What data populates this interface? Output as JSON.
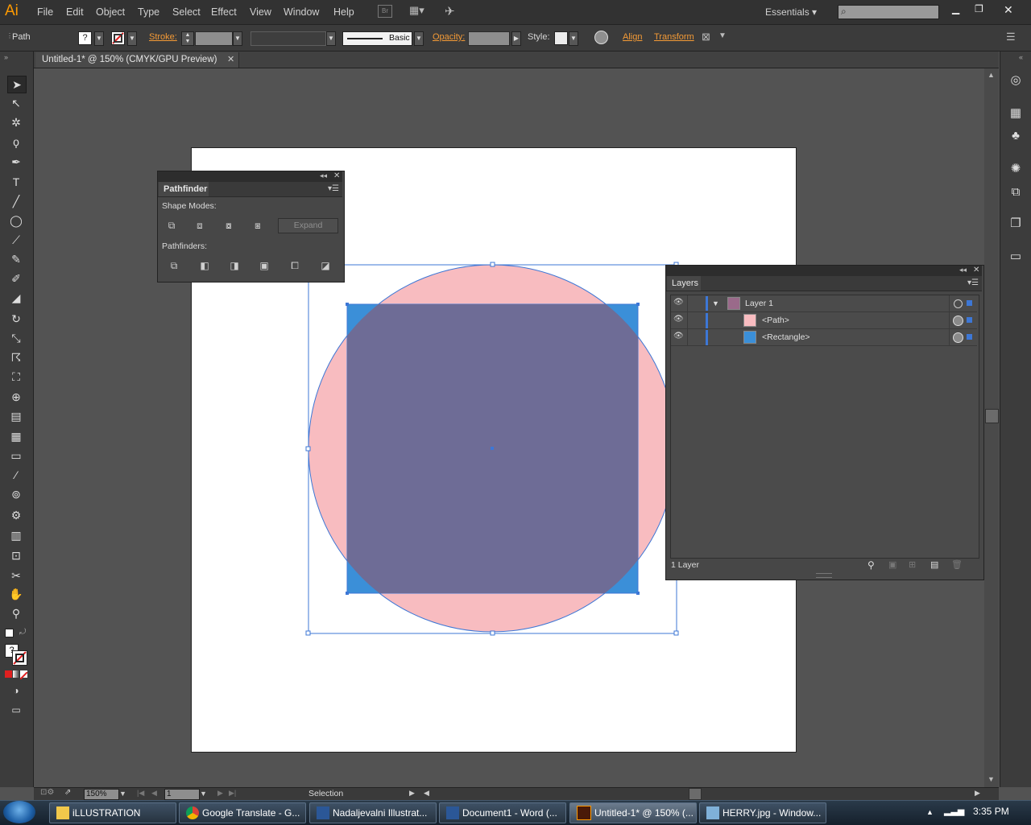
{
  "app": {
    "logo": "Ai"
  },
  "menu": [
    "File",
    "Edit",
    "Object",
    "Type",
    "Select",
    "Effect",
    "View",
    "Window",
    "Help"
  ],
  "workspace": {
    "label": "Essentials",
    "search_placeholder": ""
  },
  "control_bar": {
    "selection_type": "Path",
    "fill_glyph": "?",
    "stroke_label": "Stroke:",
    "brush_label": "Basic",
    "opacity_label": "Opacity:",
    "style_label": "Style:",
    "align_label": "Align",
    "transform_label": "Transform"
  },
  "document": {
    "tab_title": "Untitled-1* @ 150% (CMYK/GPU Preview)"
  },
  "pathfinder": {
    "title": "Pathfinder",
    "shape_modes_label": "Shape Modes:",
    "pathfinders_label": "Pathfinders:",
    "expand_label": "Expand"
  },
  "layers": {
    "title": "Layers",
    "rows": [
      {
        "name": "Layer 1",
        "swatch": "#9a6a8a"
      },
      {
        "name": "<Path>",
        "swatch": "#f8bcc0"
      },
      {
        "name": "<Rectangle>",
        "swatch": "#3b8fd8"
      }
    ],
    "count": "1 Layer"
  },
  "status": {
    "zoom": "150%",
    "page": "1",
    "tool": "Selection"
  },
  "taskbar": {
    "tasks": [
      "iLLUSTRATION",
      "Google Translate - G...",
      "Nadaljevalni Illustrat...",
      "Document1 - Word (...",
      "Untitled-1* @ 150% (...",
      "HERRY.jpg - Window..."
    ],
    "clock": "3:35 PM"
  },
  "colors": {
    "circle_fill": "#f8bcc0",
    "rect_fill": "#3b8fd8",
    "overlap": "#6e6c96",
    "accent": "#f39a36",
    "selection": "#3d77d6"
  },
  "icons": [
    "selection-tool-icon",
    "direct-selection-tool-icon",
    "magic-wand-tool-icon",
    "lasso-tool-icon",
    "pen-tool-icon",
    "type-tool-icon",
    "line-tool-icon",
    "ellipse-tool-icon",
    "paintbrush-tool-icon",
    "pencil-tool-icon",
    "blob-brush-tool-icon",
    "eraser-tool-icon",
    "rotate-tool-icon",
    "scale-tool-icon",
    "warp-tool-icon",
    "free-transform-tool-icon",
    "shape-builder-tool-icon",
    "perspective-grid-tool-icon",
    "mesh-tool-icon",
    "gradient-tool-icon",
    "eyedropper-tool-icon",
    "blend-tool-icon",
    "symbol-sprayer-tool-icon",
    "graph-tool-icon",
    "artboard-tool-icon",
    "slice-tool-icon",
    "hand-tool-icon",
    "zoom-tool-icon"
  ]
}
